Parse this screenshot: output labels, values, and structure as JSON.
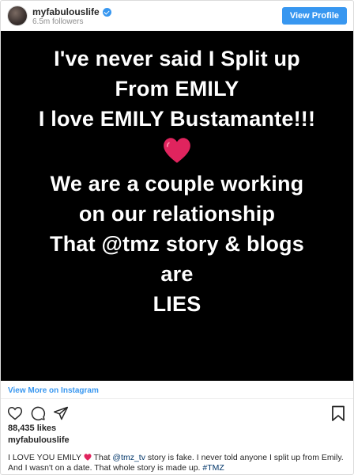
{
  "header": {
    "username": "myfabulouslife",
    "followers": "6.5m followers",
    "view_profile": "View Profile",
    "avatar_icon": "profile-avatar",
    "verified_icon": "verified-badge-icon"
  },
  "media": {
    "background": "#000000",
    "lines": [
      "I've never said I Split up",
      "From EMILY",
      "I love EMILY Bustamante!!!"
    ],
    "heart_icon": "red-heart-emoji",
    "lines_after": [
      "We are a couple working",
      "on our relationship",
      "That @tmz story & blogs",
      "are",
      "LIES"
    ]
  },
  "view_more": "View More on Instagram",
  "actions": {
    "like_icon": "heart-outline-icon",
    "comment_icon": "comment-icon",
    "share_icon": "share-icon",
    "save_icon": "bookmark-icon"
  },
  "likes": "88,435 likes",
  "caption": {
    "username": "myfabulouslife",
    "text_1": "I LOVE YOU EMILY",
    "text_2": " That ",
    "mention": "@tmz_tv",
    "text_3": " story is fake. I never told anyone I split up from Emily. And I wasn't on a date. That whole story is made up. ",
    "hashtag": "#TMZ"
  },
  "colors": {
    "accent": "#3897f0",
    "heart": "#e0245e",
    "link": "#003569"
  }
}
